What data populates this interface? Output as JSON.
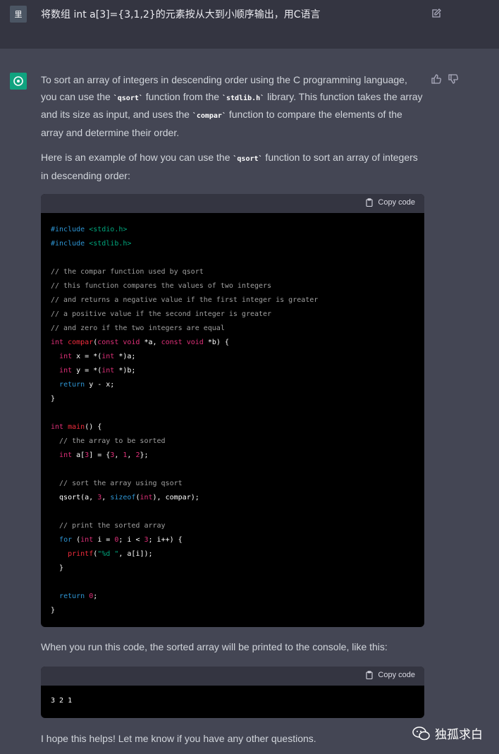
{
  "user": {
    "avatar_text": "里",
    "message": "将数组 int a[3]={3,1,2}的元素按从大到小顺序输出，用C语言"
  },
  "assistant": {
    "p1_a": "To sort an array of integers in descending order using the C programming language, you can use the ",
    "p1_code1": "`qsort`",
    "p1_b": " function from the ",
    "p1_code2": "`stdlib.h`",
    "p1_c": " library. This function takes the array and its size as input, and uses the ",
    "p1_code3": "`compar`",
    "p1_d": " function to compare the elements of the array and determine their order.",
    "p2_a": "Here is an example of how you can use the ",
    "p2_code": "`qsort`",
    "p2_b": " function to sort an array of integers in descending order:",
    "p3": "When you run this code, the sorted array will be printed to the console, like this:",
    "p4": "I hope this helps! Let me know if you have any other questions.",
    "copy_label": "Copy code",
    "code1_lines": [
      "#include <stdio.h>",
      "#include <stdlib.h>",
      "",
      "// the compar function used by qsort",
      "// this function compares the values of two integers",
      "// and returns a negative value if the first integer is greater",
      "// a positive value if the second integer is greater",
      "// and zero if the two integers are equal",
      "int compar(const void *a, const void *b) {",
      "  int x = *(int *)a;",
      "  int y = *(int *)b;",
      "  return y - x;",
      "}",
      "",
      "int main() {",
      "  // the array to be sorted",
      "  int a[3] = {3, 1, 2};",
      "",
      "  // sort the array using qsort",
      "  qsort(a, 3, sizeof(int), compar);",
      "",
      "  // print the sorted array",
      "  for (int i = 0; i < 3; i++) {",
      "    printf(\"%d \", a[i]);",
      "  }",
      "",
      "  return 0;",
      "}"
    ],
    "code2": "3 2 1"
  },
  "watermark": "独孤求白",
  "colors": {
    "accent": "#10a37f",
    "bg_assistant": "#444654",
    "bg_user": "#343541"
  }
}
